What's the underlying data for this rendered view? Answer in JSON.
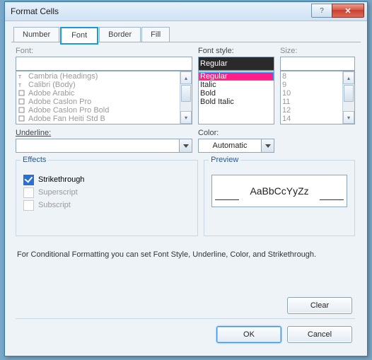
{
  "window": {
    "title": "Format Cells"
  },
  "tabs": {
    "items": [
      "Number",
      "Font",
      "Border",
      "Fill"
    ],
    "active_index": 1
  },
  "font": {
    "label": "Font:",
    "value": "",
    "list": [
      {
        "icon": "heading-font-icon",
        "label": "Cambria (Headings)"
      },
      {
        "icon": "body-font-icon",
        "label": "Calibri (Body)"
      },
      {
        "icon": "font-icon",
        "label": "Adobe Arabic"
      },
      {
        "icon": "font-icon",
        "label": "Adobe Caslon Pro"
      },
      {
        "icon": "font-icon",
        "label": "Adobe Caslon Pro Bold"
      },
      {
        "icon": "font-icon",
        "label": "Adobe Fan Heiti Std B"
      }
    ]
  },
  "style": {
    "label": "Font style:",
    "value": "Regular",
    "list": [
      "Regular",
      "Italic",
      "Bold",
      "Bold Italic"
    ],
    "highlight_index": 0
  },
  "size": {
    "label": "Size:",
    "value": "",
    "list": [
      "8",
      "9",
      "10",
      "11",
      "12",
      "14"
    ]
  },
  "underline": {
    "label": "Underline:",
    "value": ""
  },
  "color": {
    "label": "Color:",
    "value": "Automatic"
  },
  "effects": {
    "title": "Effects",
    "strikethrough": {
      "label": "Strikethrough",
      "checked": true,
      "enabled": true
    },
    "superscript": {
      "label": "Superscript",
      "checked": false,
      "enabled": false
    },
    "subscript": {
      "label": "Subscript",
      "checked": false,
      "enabled": false
    }
  },
  "preview": {
    "title": "Preview",
    "sample": "AaBbCcYyZz"
  },
  "info": "For Conditional Formatting you can set Font Style, Underline, Color, and Strikethrough.",
  "buttons": {
    "clear": "Clear",
    "ok": "OK",
    "cancel": "Cancel"
  },
  "winbtns": {
    "help": "?",
    "close": "✕"
  }
}
